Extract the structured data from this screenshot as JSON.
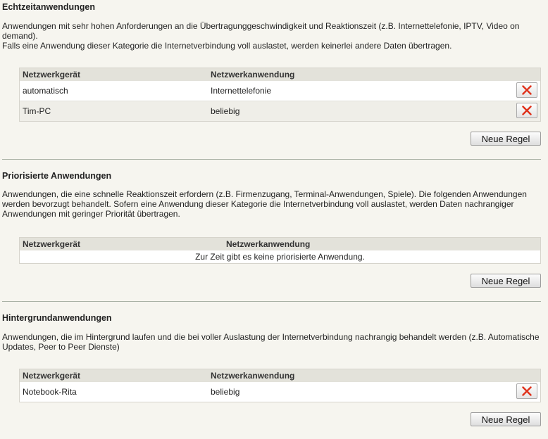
{
  "sections": [
    {
      "title": "Echtzeitanwendungen",
      "desc_lines": [
        "Anwendungen mit sehr hohen Anforderungen an die Übertragunggeschwindigkeit und Reaktionszeit (z.B. Internettelefonie, IPTV, Video on demand).",
        "Falls eine Anwendung dieser Kategorie die Internetverbindung voll auslastet, werden keinerlei andere Daten übertragen."
      ],
      "col_device": "Netzwerkgerät",
      "col_app": "Netzwerkanwendung",
      "rows": [
        {
          "device": "automatisch",
          "app": "Internettelefonie"
        },
        {
          "device": "Tim-PC",
          "app": "beliebig"
        }
      ],
      "new_rule_label": "Neue Regel"
    },
    {
      "title": "Priorisierte Anwendungen",
      "desc_lines": [
        "Anwendungen, die eine schnelle Reaktionszeit erfordern (z.B. Firmenzugang, Terminal-Anwendungen, Spiele). Die folgenden Anwendungen werden bevorzugt behandelt. Sofern eine Anwendung dieser Kategorie die Internetverbindung voll auslastet, werden Daten nachrangiger Anwendungen mit geringer Priorität übertragen."
      ],
      "col_device": "Netzwerkgerät",
      "col_app": "Netzwerkanwendung",
      "empty_text": "Zur Zeit gibt es keine priorisierte Anwendung.",
      "new_rule_label": "Neue Regel"
    },
    {
      "title": "Hintergrundanwendungen",
      "desc_lines": [
        "Anwendungen, die im Hintergrund laufen und die bei voller Auslastung der Internetverbindung nachrangig behandelt werden (z.B. Automatische Updates, Peer to Peer Dienste)"
      ],
      "col_device": "Netzwerkgerät",
      "col_app": "Netzwerkanwendung",
      "rows": [
        {
          "device": "Notebook-Rita",
          "app": "beliebig"
        }
      ],
      "new_rule_label": "Neue Regel"
    }
  ],
  "icons": {
    "delete": "delete-x-icon"
  },
  "colors": {
    "delete_x": "#e0311b",
    "background": "#f6f5ef",
    "divider": "#a9b1a5"
  }
}
